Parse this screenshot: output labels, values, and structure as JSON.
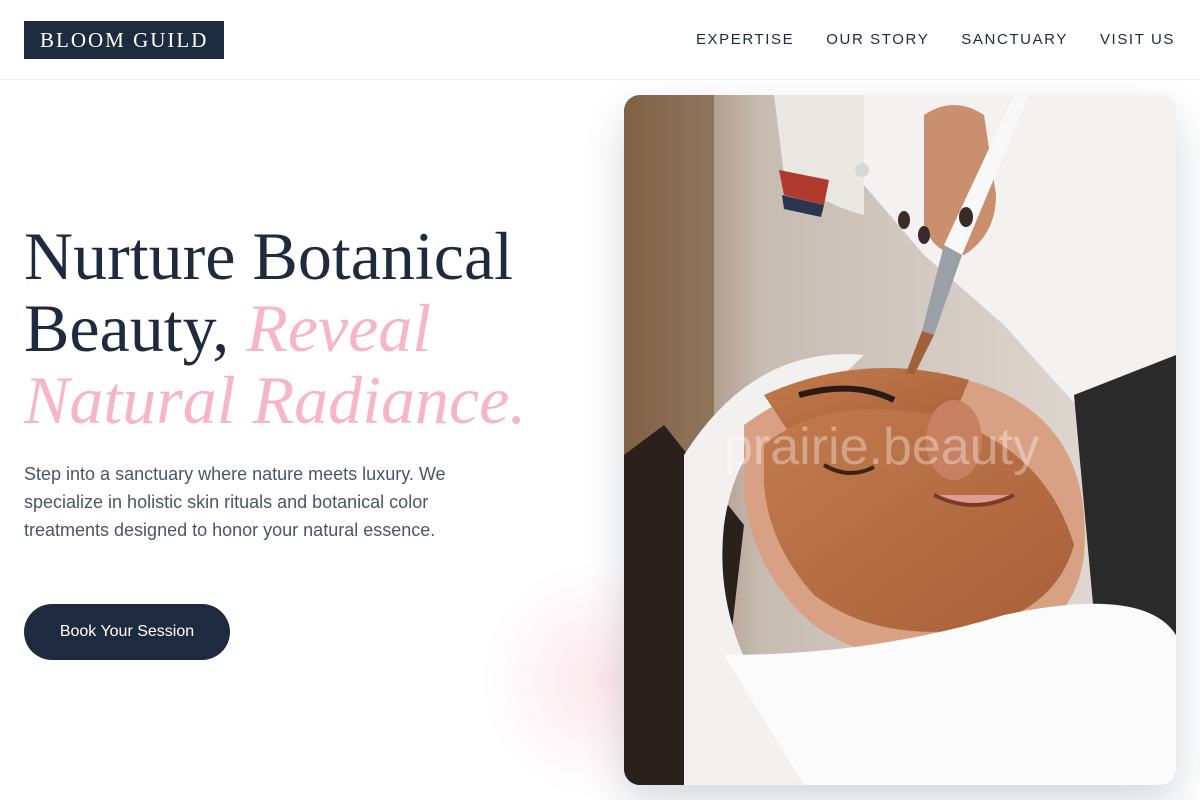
{
  "header": {
    "logo": "BLOOM GUILD",
    "nav": [
      "EXPERTISE",
      "OUR STORY",
      "SANCTUARY",
      "VISIT US"
    ]
  },
  "hero": {
    "headline_part1": "Nurture Botanical Beauty, ",
    "headline_accent": "Reveal Natural Radiance.",
    "intro": "Step into a sanctuary where nature meets luxury. We specialize in holistic skin rituals and botanical color treatments designed to honor your natural essence.",
    "cta_label": "Book Your Session",
    "image_watermark": "prairie.beauty"
  },
  "colors": {
    "navy": "#1e2a3e",
    "pink_accent": "#f7b6c8",
    "body_text": "#4a5568"
  }
}
